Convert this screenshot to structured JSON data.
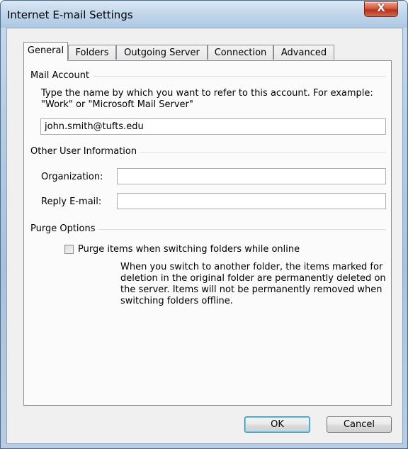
{
  "window": {
    "title": "Internet E-mail Settings",
    "close_glyph": "X"
  },
  "tabs": [
    {
      "label": "General",
      "active": true
    },
    {
      "label": "Folders",
      "active": false
    },
    {
      "label": "Outgoing Server",
      "active": false
    },
    {
      "label": "Connection",
      "active": false
    },
    {
      "label": "Advanced",
      "active": false
    }
  ],
  "mail_account": {
    "group_label": "Mail Account",
    "description": "Type the name by which you want to refer to this account. For example: \"Work\" or \"Microsoft Mail Server\"",
    "account_name_value": "john.smith@tufts.edu"
  },
  "other_user_info": {
    "group_label": "Other User Information",
    "organization_label": "Organization:",
    "organization_value": "",
    "reply_email_label": "Reply E-mail:",
    "reply_email_value": ""
  },
  "purge_options": {
    "group_label": "Purge Options",
    "checkbox_label": "Purge items when switching folders while online",
    "checked": false,
    "description": "When you switch to another folder, the items marked for deletion in the original folder are permanently deleted on the server. Items will not be permanently removed when switching folders offline."
  },
  "buttons": {
    "ok_label": "OK",
    "cancel_label": "Cancel"
  }
}
